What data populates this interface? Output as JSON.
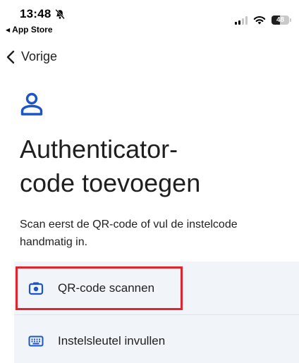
{
  "status_bar": {
    "time": "13:48",
    "back_app_label": "App Store",
    "battery_level": "48",
    "battery_fraction": 0.48,
    "icons": [
      "bell-slash-icon",
      "signal-icon",
      "wifi-icon",
      "battery-icon"
    ]
  },
  "nav": {
    "back_label": "Vorige",
    "back_icon": "chevron-left-icon"
  },
  "header": {
    "icon": "person-icon",
    "title": "Authenticator-\ncode toevoegen",
    "description": "Scan eerst de QR-code of vul de instelcode handmatig in."
  },
  "options": [
    {
      "icon": "camera-icon",
      "label": "QR-code scannen"
    },
    {
      "icon": "keyboard-icon",
      "label": "Instelsleutel invullen"
    }
  ],
  "colors": {
    "accent": "#1a56c6",
    "option_background": "#f1f4f9",
    "highlight": "#e0242e",
    "text": "#1f1f1f"
  }
}
